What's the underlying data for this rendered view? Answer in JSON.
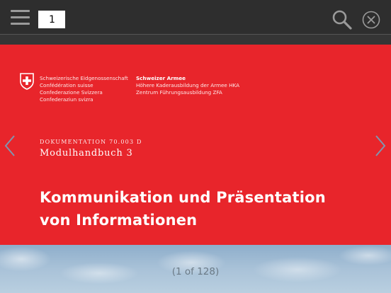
{
  "toolbar": {
    "menu_icon": "hamburger-menu-icon",
    "page_number_value": "1",
    "search_icon": "search-icon",
    "close_icon": "close-circle-icon"
  },
  "document": {
    "header_left": [
      "Schweizerische Eidgenossenschaft",
      "Confédération suisse",
      "Confederazione Svizzera",
      "Confederaziun svizra"
    ],
    "header_right_title": "Schweizer Armee",
    "header_right_lines": [
      "Höhere Kaderausbildung der Armee HKA",
      "Zentrum Führungsausbildung ZFA"
    ],
    "doc_label": "DOKUMENTATION 70.003 D",
    "doc_subtitle": "Modulhandbuch 3",
    "title_line1": "Kommunikation und Präsentation",
    "title_line2": "von Informationen",
    "crest_icon": "swiss-crest-icon",
    "accent_color": "#e8252b"
  },
  "navigation": {
    "prev_icon": "chevron-left-icon",
    "next_icon": "chevron-right-icon",
    "page_indicator": "(1 of 128)"
  }
}
